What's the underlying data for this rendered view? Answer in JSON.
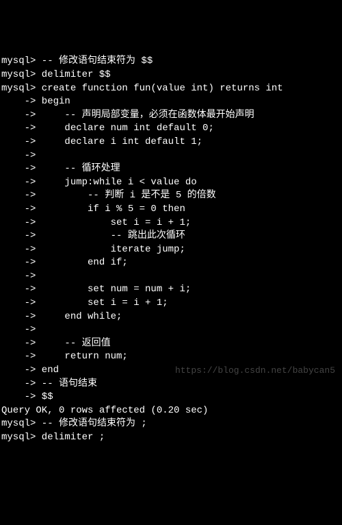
{
  "lines": [
    "mysql> -- 修改语句结束符为 $$",
    "mysql> delimiter $$",
    "mysql> create function fun(value int) returns int",
    "    -> begin",
    "    ->     -- 声明局部变量，必须在函数体最开始声明",
    "    ->     declare num int default 0;",
    "    ->     declare i int default 1;",
    "    ->",
    "    ->     -- 循环处理",
    "    ->     jump:while i < value do",
    "    ->         -- 判断 i 是不是 5 的倍数",
    "    ->         if i % 5 = 0 then",
    "    ->             set i = i + 1;",
    "    ->             -- 跳出此次循环",
    "    ->             iterate jump;",
    "    ->         end if;",
    "    ->",
    "    ->         set num = num + i;",
    "    ->         set i = i + 1;",
    "    ->     end while;",
    "    ->",
    "    ->     -- 返回值",
    "    ->     return num;",
    "    -> end",
    "    -> -- 语句结束",
    "    -> $$",
    "Query OK, 0 rows affected (0.20 sec)",
    "",
    "mysql> -- 修改语句结束符为 ;",
    "mysql> delimiter ;"
  ],
  "watermark": "https://blog.csdn.net/babycan5"
}
